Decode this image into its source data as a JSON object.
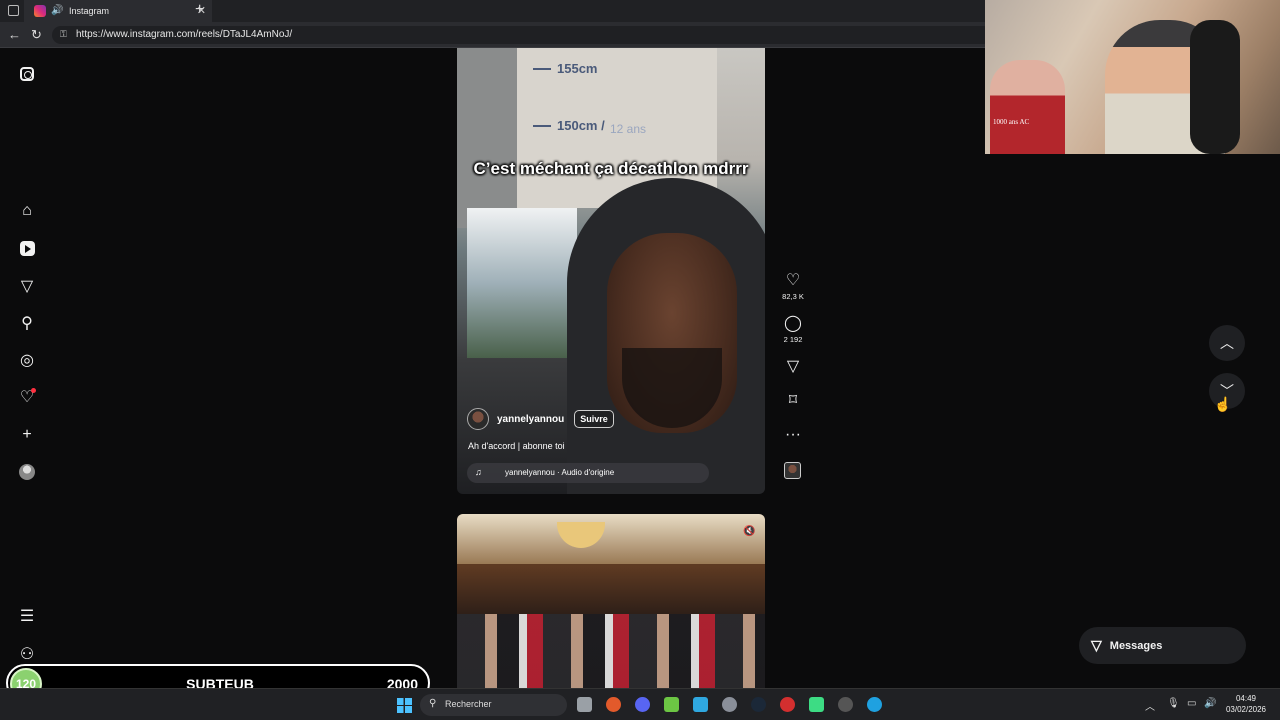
{
  "browser": {
    "tab_title": "Instagram",
    "url": "https://www.instagram.com/reels/DTaJL4AmNoJ/"
  },
  "sidebar": {
    "items": [
      {
        "name": "instagram-logo-icon"
      },
      {
        "name": "home-icon"
      },
      {
        "name": "reels-icon"
      },
      {
        "name": "direct-messages-icon"
      },
      {
        "name": "search-icon"
      },
      {
        "name": "explore-icon"
      },
      {
        "name": "notifications-icon"
      },
      {
        "name": "create-icon"
      },
      {
        "name": "profile-icon"
      },
      {
        "name": "more-menu-icon"
      },
      {
        "name": "also-from-meta-icon"
      }
    ]
  },
  "reel": {
    "overlay_caption": "C’est méchant ça décathlon mdrrr",
    "measure_1": "155cm",
    "measure_2": "150cm /",
    "measure_2b": "12 ans",
    "author": "yannelyannou",
    "follow_label": "Suivre",
    "description": "Ah d'accord | abonne toi",
    "audio": "yannelyannou · Audio d'origine"
  },
  "actions": {
    "likes": "82,3 K",
    "comments": "2 192"
  },
  "messages_label": "Messages",
  "webcam": {
    "shirt_text": "1000 ans AC"
  },
  "sub_counter": {
    "current": "120",
    "label": "SUBTEUB",
    "goal": "2000"
  },
  "taskbar": {
    "search_placeholder": "Rechercher",
    "time": "04:49",
    "date": "03/02/2026"
  }
}
